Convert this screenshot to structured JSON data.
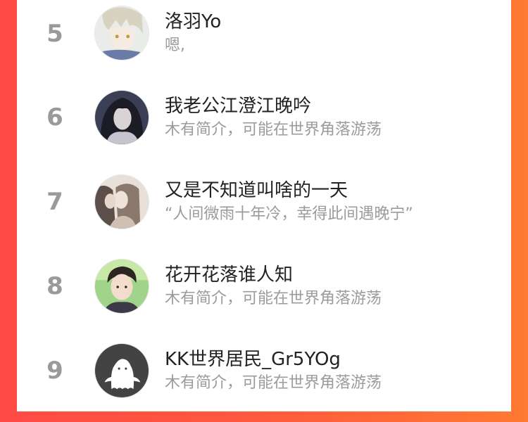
{
  "list": {
    "rows": [
      {
        "rank": "5",
        "name": "洛羽Yo",
        "bio": "嗯,",
        "avatar": "anime-boy-avatar"
      },
      {
        "rank": "6",
        "name": "我老公江澄江晚吟",
        "bio": "木有简介，可能在世界角落游荡",
        "avatar": "dark-hair-avatar"
      },
      {
        "rank": "7",
        "name": "又是不知道叫啥的一天",
        "bio": "“人间微雨十年冷，幸得此间遇晚宁”",
        "avatar": "couple-avatar"
      },
      {
        "rank": "8",
        "name": "花开花落谁人知",
        "bio": "木有简介，可能在世界角落游荡",
        "avatar": "young-man-avatar"
      },
      {
        "rank": "9",
        "name": "KK世界居民_Gr5YOg",
        "bio": "木有简介，可能在世界角落游荡",
        "avatar": "default-ghost-avatar"
      }
    ]
  },
  "colors": {
    "background_left": "#ff4a45",
    "background_right": "#ff7a33",
    "rank": "#9a9a9a",
    "name": "#222222",
    "bio": "#9b9b9b"
  }
}
